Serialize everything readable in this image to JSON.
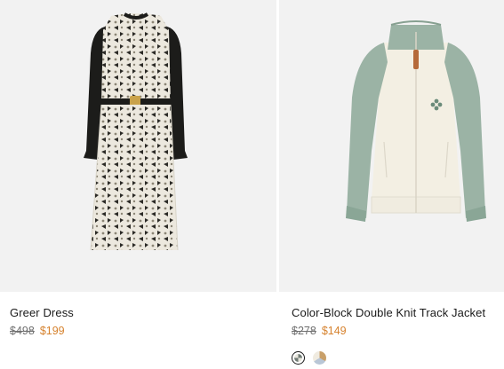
{
  "products": [
    {
      "name": "Greer Dress",
      "original_price": "$498",
      "sale_price": "$199",
      "image_icon": "dress-product-image"
    },
    {
      "name": "Color-Block Double Knit Track Jacket",
      "original_price": "$278",
      "sale_price": "$149",
      "image_icon": "jacket-product-image",
      "swatches": [
        {
          "name": "green-ivory-swatch",
          "selected": true
        },
        {
          "name": "multi-swatch",
          "selected": false
        }
      ]
    }
  ],
  "colors": {
    "sale": "#d6822e",
    "strikethrough": "#6f6f6f",
    "image_bg": "#f2f2f2"
  }
}
